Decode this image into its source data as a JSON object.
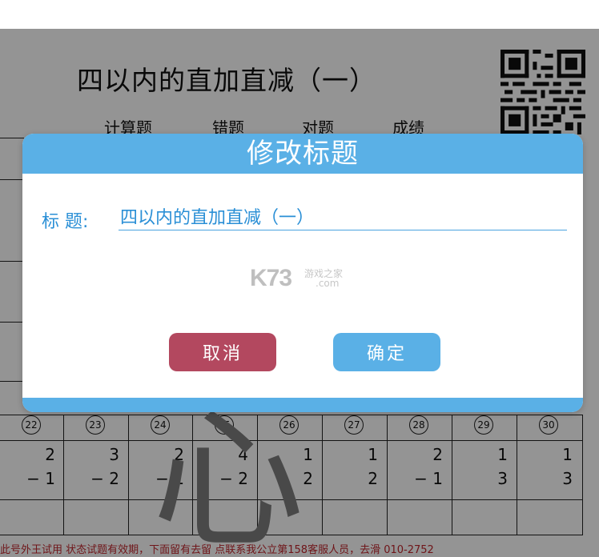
{
  "worksheet": {
    "title": "四以内的直加直减（一）",
    "score_headers": [
      "计算题",
      "错题",
      "对题",
      "成绩"
    ],
    "grid": {
      "numbers": [
        "22",
        "23",
        "24",
        "25",
        "26",
        "27",
        "28",
        "29",
        "30"
      ],
      "top_values": [
        "2",
        "3",
        "2",
        "4",
        "1",
        "1",
        "2",
        "1",
        "1"
      ],
      "bottom_values": [
        "− 1",
        "− 2",
        "− 1",
        "− 2",
        "2",
        "2",
        "− 1",
        "3",
        "3"
      ]
    },
    "watermark_char": "心",
    "bottom_note": "此号外王试用 状态试题有效期，下面留有去留 点联系我公立第158客服人员，去滑 010-2752"
  },
  "dialog": {
    "title": "修改标题",
    "field_label": "标 题:",
    "field_value": "四以内的直加直减（一）",
    "cancel_label": "取消",
    "ok_label": "确定",
    "watermark_main": "K73",
    "watermark_sub1": "游戏之家",
    "watermark_sub2": ".com"
  },
  "colors": {
    "accent": "#5ab0e6",
    "cancel": "#b3485f",
    "label": "#2a8fd6",
    "overlay": "rgba(0,0,0,0.42)"
  }
}
